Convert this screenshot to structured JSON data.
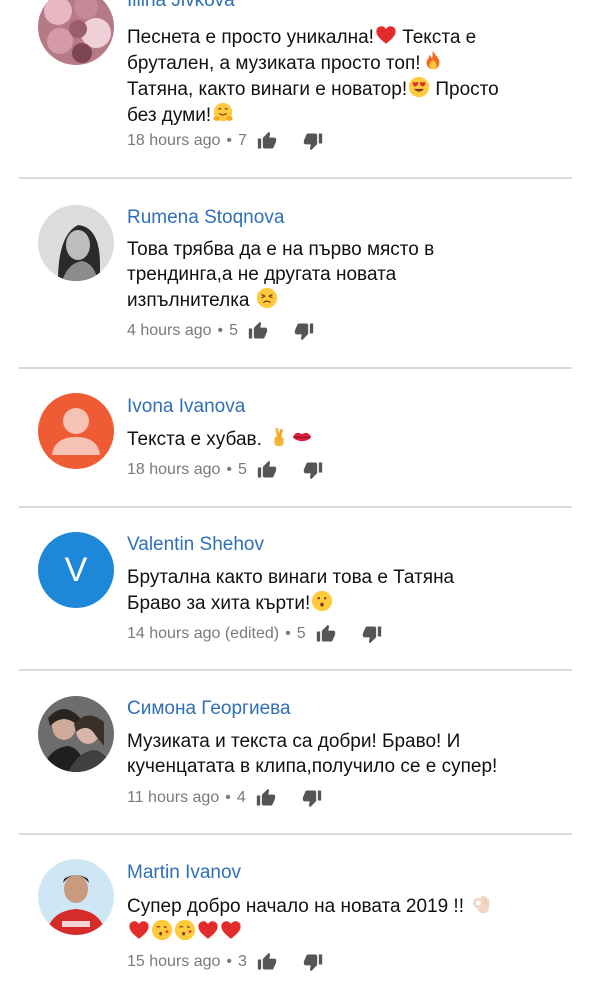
{
  "comments": [
    {
      "author": "Iliina Jivkova",
      "lines": [
        "Песнета е просто уникална!",
        "брутален, а музиката просто топ!",
        "Татяна, както винаги е новатор!",
        "без думи!"
      ],
      "line_suffix": [
        " Текста е",
        "",
        " Просто",
        ""
      ],
      "time": "18 hours ago",
      "likes": "7",
      "avatar_icon": "flowers-photo"
    },
    {
      "author": "Rumena Stoqnova",
      "lines": [
        "Това трябва да е на първо място в",
        "трендинга,а не другата новата",
        "изпълнителка"
      ],
      "time": "4 hours ago",
      "likes": "5",
      "avatar_icon": "woman-photo"
    },
    {
      "author": "Ivona Ivanova",
      "lines": [
        "Текста е хубав."
      ],
      "time": "18 hours ago",
      "likes": "5",
      "avatar_icon": "default-person-icon",
      "avatar_color": "#ee5b34"
    },
    {
      "author": "Valentin Shehov",
      "lines": [
        "Брутална както винаги това е Татяна",
        "Браво за хита кърти!"
      ],
      "time": "14 hours ago (edited)",
      "likes": "5",
      "avatar_letter": "V",
      "avatar_color": "#1e88d8"
    },
    {
      "author": "Симона Георгиева",
      "lines": [
        "Музиката и текста са добри! Браво! И",
        "кученцатата в клипа,получило се е супер!"
      ],
      "time": "11 hours ago",
      "likes": "4",
      "avatar_icon": "couple-photo"
    },
    {
      "author": "Martin Ivanov",
      "lines": [
        "Супер добро  начало на новата 2019 !!"
      ],
      "time": "15 hours ago",
      "likes": "3",
      "avatar_icon": "man-photo"
    }
  ],
  "colors": {
    "author": "#2f6fb5",
    "text": "#111111",
    "meta": "#7a7a7a",
    "separator": "#d9d9d9"
  }
}
